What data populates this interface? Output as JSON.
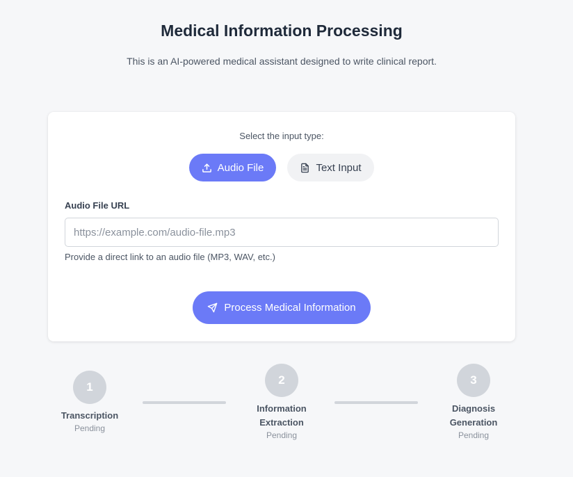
{
  "header": {
    "title": "Medical Information Processing",
    "subtitle": "This is an AI-powered medical assistant designed to write clinical report."
  },
  "form": {
    "select_label": "Select the input type:",
    "input_types": [
      {
        "label": "Audio File",
        "icon": "upload-icon",
        "selected": true
      },
      {
        "label": "Text Input",
        "icon": "document-icon",
        "selected": false
      }
    ],
    "audio_field": {
      "label": "Audio File URL",
      "value": "",
      "placeholder": "https://example.com/audio-file.mp3",
      "helper": "Provide a direct link to an audio file (MP3, WAV, etc.)"
    },
    "submit": {
      "label": "Process Medical Information",
      "icon": "send-icon"
    }
  },
  "steps": [
    {
      "number": "1",
      "name": "Transcription",
      "status": "Pending"
    },
    {
      "number": "2",
      "name": "Information Extraction",
      "status": "Pending"
    },
    {
      "number": "3",
      "name": "Diagnosis Generation",
      "status": "Pending"
    }
  ],
  "colors": {
    "accent": "#6b7af7",
    "background": "#f6f7f9",
    "step_pending": "#d1d5db"
  }
}
